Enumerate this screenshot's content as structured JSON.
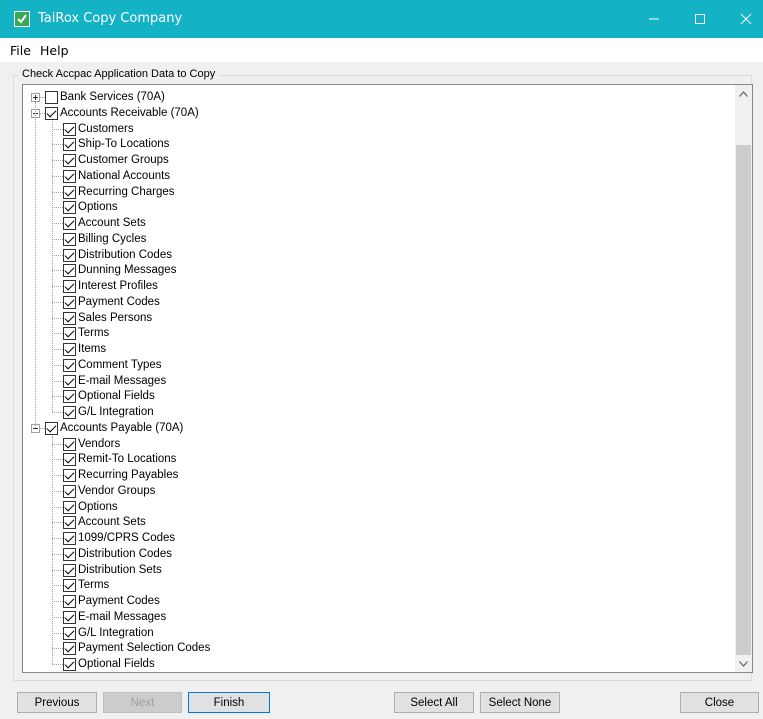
{
  "window": {
    "title": "TaiRox Copy Company"
  },
  "menu": {
    "file": "File",
    "help": "Help"
  },
  "group": {
    "label": "Check Accpac Application Data to Copy"
  },
  "tree": {
    "parents": [
      {
        "label": "Bank Services (70A)",
        "checked": false,
        "expanded": false
      },
      {
        "label": "Accounts Receivable (70A)",
        "checked": true,
        "expanded": true
      },
      {
        "label": "Accounts Payable (70A)",
        "checked": true,
        "expanded": true
      }
    ],
    "ar_children": [
      "Customers",
      "Ship-To Locations",
      "Customer Groups",
      "National Accounts",
      "Recurring Charges",
      "Options",
      "Account Sets",
      "Billing Cycles",
      "Distribution Codes",
      "Dunning Messages",
      "Interest Profiles",
      "Payment Codes",
      "Sales Persons",
      "Terms",
      "Items",
      "Comment Types",
      "E-mail Messages",
      "Optional Fields",
      "G/L Integration"
    ],
    "ap_children": [
      "Vendors",
      "Remit-To Locations",
      "Recurring Payables",
      "Vendor Groups",
      "Options",
      "Account Sets",
      "1099/CPRS Codes",
      "Distribution Codes",
      "Distribution Sets",
      "Terms",
      "Payment Codes",
      "E-mail Messages",
      "G/L Integration",
      "Payment Selection Codes",
      "Optional Fields"
    ]
  },
  "buttons": {
    "previous": "Previous",
    "next": "Next",
    "finish": "Finish",
    "select_all": "Select All",
    "select_none": "Select None",
    "close": "Close"
  }
}
